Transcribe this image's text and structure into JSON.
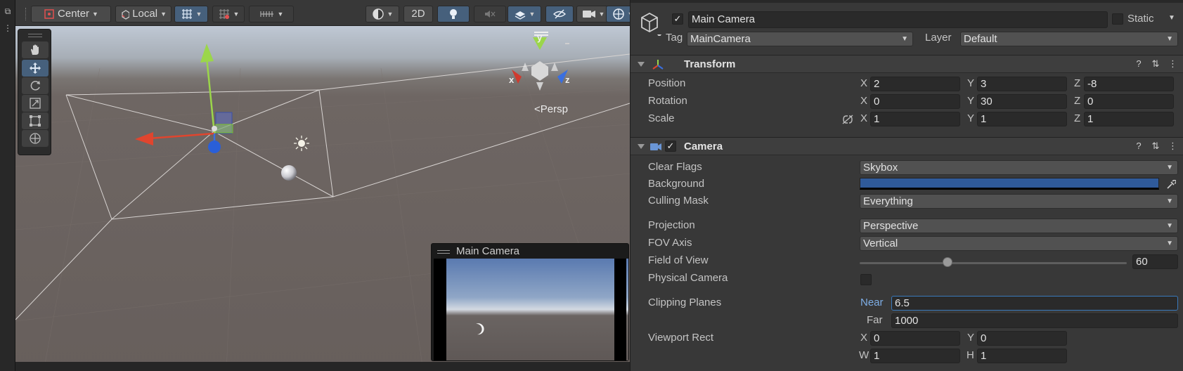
{
  "scene_toolbar": {
    "pivot_label": "Center",
    "space_label": "Local",
    "mode_2d_label": "2D"
  },
  "scene_view": {
    "projection_label": "<Persp",
    "gizmo_axis_y": "y",
    "gizmo_axis_x": "x",
    "gizmo_axis_z": "z",
    "camera_preview_title": "Main Camera"
  },
  "inspector": {
    "object_name": "Main Camera",
    "static_label": "Static",
    "tag_label": "Tag",
    "tag_value": "MainCamera",
    "layer_label": "Layer",
    "layer_value": "Default",
    "transform": {
      "title": "Transform",
      "position_label": "Position",
      "rotation_label": "Rotation",
      "scale_label": "Scale",
      "axis_x": "X",
      "axis_y": "Y",
      "axis_z": "Z",
      "position": {
        "x": "2",
        "y": "3",
        "z": "-8"
      },
      "rotation": {
        "x": "0",
        "y": "30",
        "z": "0"
      },
      "scale": {
        "x": "1",
        "y": "1",
        "z": "1"
      }
    },
    "camera": {
      "title": "Camera",
      "clear_flags_label": "Clear Flags",
      "clear_flags_value": "Skybox",
      "background_label": "Background",
      "background_color": "#2f5a9a",
      "culling_mask_label": "Culling Mask",
      "culling_mask_value": "Everything",
      "projection_label": "Projection",
      "projection_value": "Perspective",
      "fov_axis_label": "FOV Axis",
      "fov_axis_value": "Vertical",
      "fov_label": "Field of View",
      "fov_value": "60",
      "fov_fraction": 0.33,
      "physical_camera_label": "Physical Camera",
      "clipping_planes_label": "Clipping Planes",
      "near_label": "Near",
      "near_value": "6.5",
      "far_label": "Far",
      "far_value": "1000",
      "viewport_rect_label": "Viewport Rect",
      "viewport": {
        "x_label": "X",
        "y_label": "Y",
        "w_label": "W",
        "h_label": "H",
        "x": "0",
        "y": "0",
        "w": "1",
        "h": "1"
      }
    }
  }
}
